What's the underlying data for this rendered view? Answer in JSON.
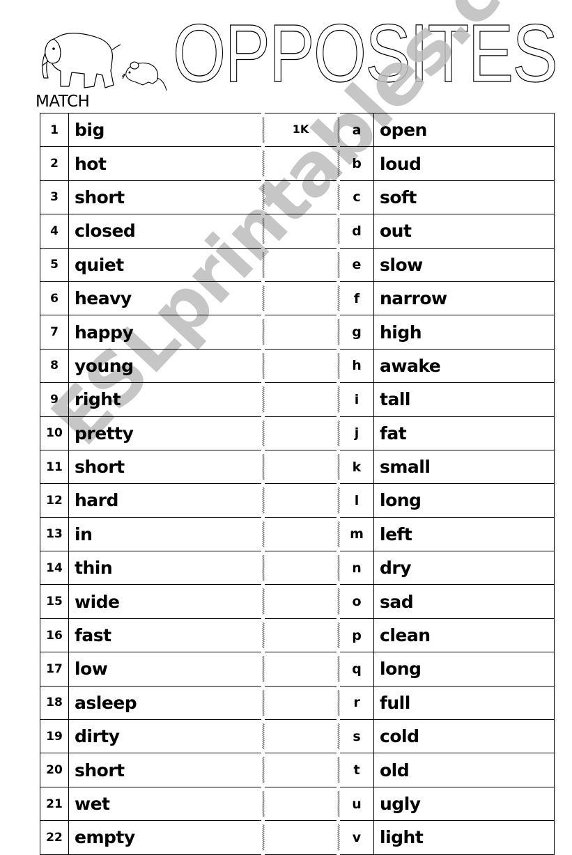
{
  "header": {
    "title": "OPPOSITES",
    "instruction": "MATCH",
    "illustrations": [
      "elephant-icon",
      "mouse-icon"
    ]
  },
  "watermark": "ESLprintables.com",
  "left_column": [
    {
      "num": "1",
      "word": "big",
      "answer": "1K"
    },
    {
      "num": "2",
      "word": "hot",
      "answer": ""
    },
    {
      "num": "3",
      "word": "short",
      "answer": ""
    },
    {
      "num": "4",
      "word": "closed",
      "answer": ""
    },
    {
      "num": "5",
      "word": "quiet",
      "answer": ""
    },
    {
      "num": "6",
      "word": "heavy",
      "answer": ""
    },
    {
      "num": "7",
      "word": "happy",
      "answer": ""
    },
    {
      "num": "8",
      "word": "young",
      "answer": ""
    },
    {
      "num": "9",
      "word": "right",
      "answer": ""
    },
    {
      "num": "10",
      "word": "pretty",
      "answer": ""
    },
    {
      "num": "11",
      "word": "short",
      "answer": ""
    },
    {
      "num": "12",
      "word": "hard",
      "answer": ""
    },
    {
      "num": "13",
      "word": "in",
      "answer": ""
    },
    {
      "num": "14",
      "word": "thin",
      "answer": ""
    },
    {
      "num": "15",
      "word": "wide",
      "answer": ""
    },
    {
      "num": "16",
      "word": "fast",
      "answer": ""
    },
    {
      "num": "17",
      "word": "low",
      "answer": ""
    },
    {
      "num": "18",
      "word": "asleep",
      "answer": ""
    },
    {
      "num": "19",
      "word": "dirty",
      "answer": ""
    },
    {
      "num": "20",
      "word": "short",
      "answer": ""
    },
    {
      "num": "21",
      "word": "wet",
      "answer": ""
    },
    {
      "num": "22",
      "word": "empty",
      "answer": ""
    }
  ],
  "right_column": [
    {
      "letter": "a",
      "word": "open"
    },
    {
      "letter": "b",
      "word": "loud"
    },
    {
      "letter": "c",
      "word": "soft"
    },
    {
      "letter": "d",
      "word": "out"
    },
    {
      "letter": "e",
      "word": "slow"
    },
    {
      "letter": "f",
      "word": "narrow"
    },
    {
      "letter": "g",
      "word": "high"
    },
    {
      "letter": "h",
      "word": "awake"
    },
    {
      "letter": "i",
      "word": "tall"
    },
    {
      "letter": "j",
      "word": "fat"
    },
    {
      "letter": "k",
      "word": "small"
    },
    {
      "letter": "l",
      "word": "long"
    },
    {
      "letter": "m",
      "word": "left"
    },
    {
      "letter": "n",
      "word": "dry"
    },
    {
      "letter": "o",
      "word": "sad"
    },
    {
      "letter": "p",
      "word": "clean"
    },
    {
      "letter": "q",
      "word": "long"
    },
    {
      "letter": "r",
      "word": "full"
    },
    {
      "letter": "s",
      "word": "cold"
    },
    {
      "letter": "t",
      "word": "old"
    },
    {
      "letter": "u",
      "word": "ugly"
    },
    {
      "letter": "v",
      "word": "light"
    }
  ]
}
